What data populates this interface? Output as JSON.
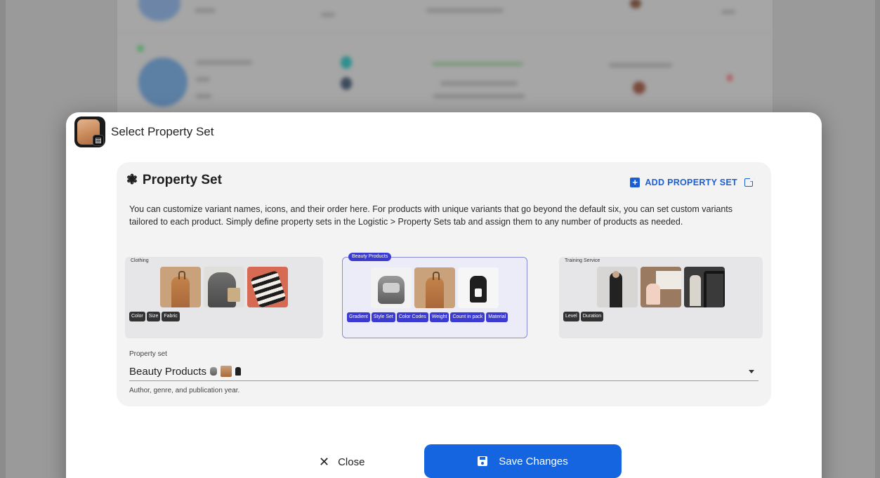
{
  "modal": {
    "title": "Select Property Set"
  },
  "card": {
    "title": "Property Set",
    "add_button_label": "ADD PROPERTY SET",
    "description": "You can customize variant names, icons, and their order here. For products with unique variants that go beyond the default six, you can set custom variants tailored to each product. Simply define property sets in the Logistic > Property Sets tab and assign them to any number of products as needed."
  },
  "sets": [
    {
      "label": "Clothing",
      "selected": false,
      "chips": [
        "Color",
        "Size",
        "Fabric"
      ]
    },
    {
      "label": "Beauty Products",
      "selected": true,
      "chips": [
        "Gradient",
        "Style Set",
        "Color Codes",
        "Weight",
        "Count in pack",
        "Material"
      ]
    },
    {
      "label": "Training Service",
      "selected": false,
      "chips": [
        "Level",
        "Duration"
      ]
    }
  ],
  "field": {
    "label": "Property set",
    "value": "Beauty Products",
    "helper": "Author, genre, and publication year."
  },
  "footer": {
    "close_label": "Close",
    "save_label": "Save Changes"
  },
  "icons": {
    "title_icon": "property-set-icon",
    "add": "plus-square-icon",
    "external": "external-link-icon",
    "close": "close-icon",
    "save": "floppy-disk-icon",
    "dropdown": "caret-down-icon"
  },
  "colors": {
    "accent": "#1565e0",
    "selected_set": "#3b3bd1"
  }
}
